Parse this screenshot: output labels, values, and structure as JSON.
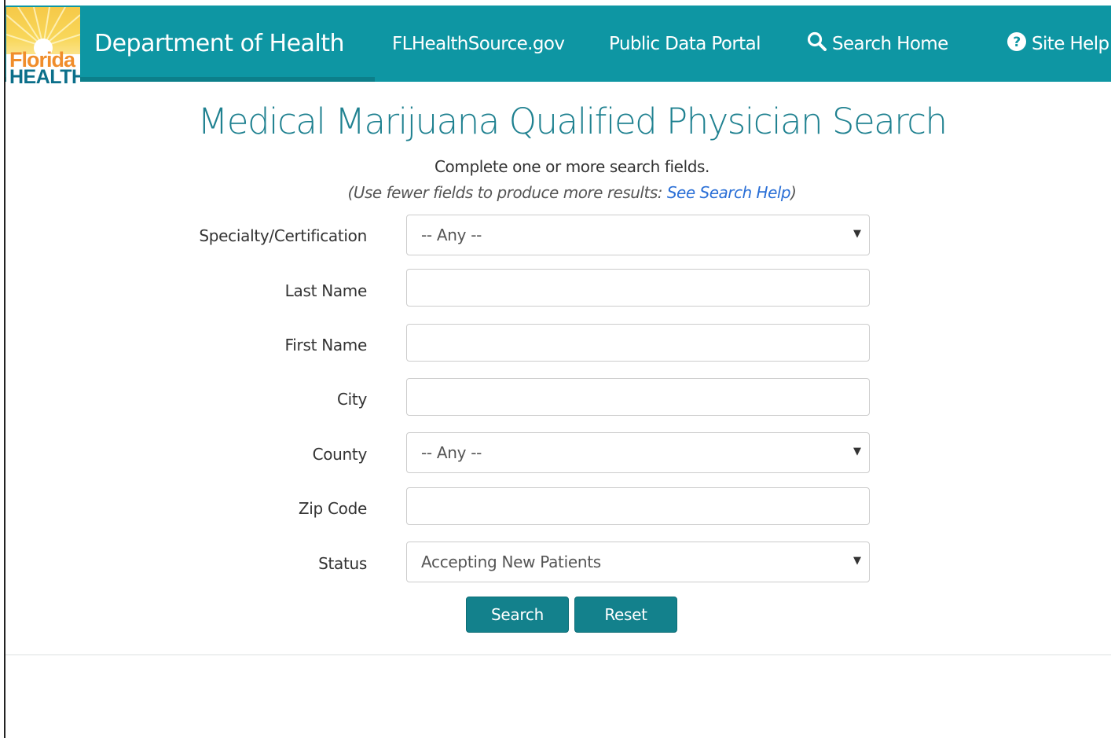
{
  "header": {
    "logo_text_1": "Florida",
    "logo_text_2": "HEALTH",
    "brand": "Department of Health",
    "links": [
      {
        "label": "FLHealthSource.gov"
      },
      {
        "label": "Public Data Portal"
      },
      {
        "label": "Search Home",
        "icon": "search-icon"
      },
      {
        "label": "Site Help",
        "icon": "question-circle-icon"
      }
    ]
  },
  "colors": {
    "navbar": "#0e96a3",
    "title": "#1f8190",
    "button": "#13818c",
    "link": "#2a6fd6"
  },
  "page": {
    "title": "Medical Marijuana Qualified Physician Search",
    "instruction": "Complete one or more search fields.",
    "hint_prefix": "(Use fewer fields to produce more results: ",
    "hint_link": "See Search Help",
    "hint_suffix": ")"
  },
  "form": {
    "specialty": {
      "label": "Specialty/Certification",
      "value": "-- Any --"
    },
    "last_name": {
      "label": "Last Name",
      "value": ""
    },
    "first_name": {
      "label": "First Name",
      "value": ""
    },
    "city": {
      "label": "City",
      "value": ""
    },
    "county": {
      "label": "County",
      "value": "-- Any --"
    },
    "zip": {
      "label": "Zip Code",
      "value": ""
    },
    "status": {
      "label": "Status",
      "value": "Accepting New Patients"
    },
    "search_label": "Search",
    "reset_label": "Reset"
  }
}
